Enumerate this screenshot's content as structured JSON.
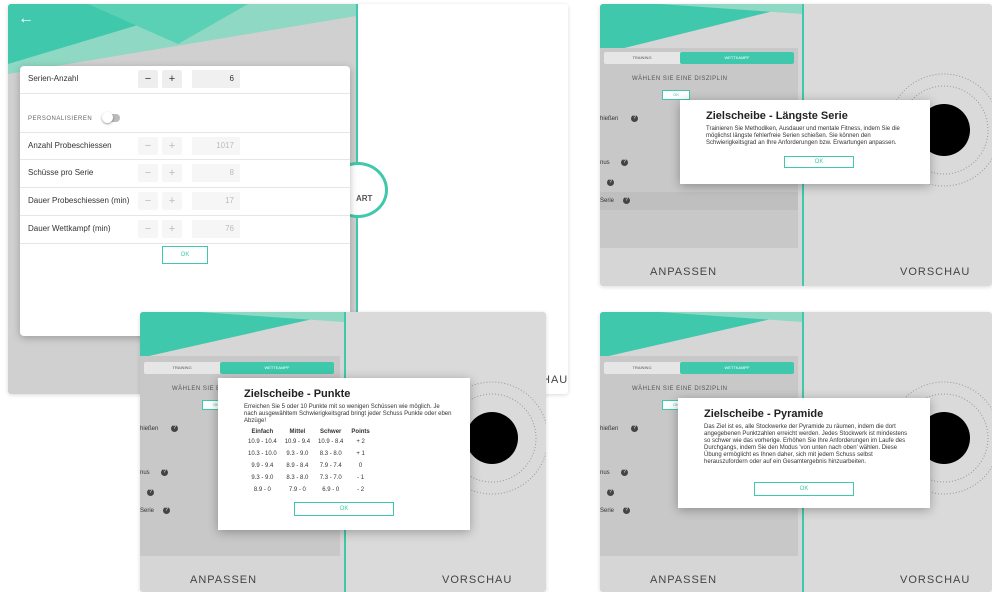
{
  "colors": {
    "accent": "#3fc8ab",
    "dark_green": "#2a8a73",
    "target_black": "#000000"
  },
  "main": {
    "back_icon": "arrow-left",
    "rows": [
      {
        "label": "Serien-Anzahl",
        "minus": "−",
        "plus": "+",
        "value": "6",
        "enabled": true
      },
      {
        "label": "Anzahl Probeschiessen",
        "minus": "−",
        "plus": "+",
        "value": "1017",
        "enabled": false
      },
      {
        "label": "Schüsse pro Serie",
        "minus": "−",
        "plus": "+",
        "value": "8",
        "enabled": false
      },
      {
        "label": "Dauer Probeschiessen (min)",
        "minus": "−",
        "plus": "+",
        "value": "17",
        "enabled": false
      },
      {
        "label": "Dauer Wettkampf (min)",
        "minus": "−",
        "plus": "+",
        "value": "76",
        "enabled": false
      }
    ],
    "personalize_label": "PERSONALISIEREN",
    "ok_label": "OK",
    "start_fragment": "ART",
    "vorschau_fragment": "HAU"
  },
  "common": {
    "tab_training": "TRAINING",
    "tab_wettkampf": "WETTKAMPF",
    "choose_label": "WÄHLEN SIE EINE DISZIPLIN",
    "ok_label": "OK",
    "footer_left": "ANPASSEN",
    "footer_right": "VORSCHAU"
  },
  "shot_top_right": {
    "choose_label": "WÄHLEN SIE EINE DISZIPLIN",
    "list": [
      "hießen",
      "nus",
      "",
      "Serie"
    ],
    "dialog_title": "Zielscheibe - Längste Serie",
    "dialog_body": "Trainieren Sie Methodiken, Ausdauer und mentale Fitness, indem Sie die möglichst längste fehlerfreie Serien schießen. Sie können den Schwierigkeitsgrad an Ihre Anforderungen bzw. Erwartungen anpassen.",
    "dialog_ok": "OK"
  },
  "shot_bottom_left": {
    "choose_label": "WÄHLEN SIE E",
    "list": [
      "hießen",
      "nus",
      "",
      "Serie"
    ],
    "dialog_title": "Zielscheibe - Punkte",
    "dialog_body": "Erreichen Sie 5 oder 10 Punkte mit so wenigen Schüssen wie möglich. Je nach ausgewähltem Schwierigkeitsgrad bringt jeder Schuss Punkte oder eben Abzüge!",
    "table_headers": [
      "Einfach",
      "Mittel",
      "Schwer",
      "Points"
    ],
    "table_rows": [
      [
        "10.9 - 10.4",
        "10.9 - 9.4",
        "10.9 - 8.4",
        "+ 2"
      ],
      [
        "10.3 - 10.0",
        "9.3 - 9.0",
        "8.3 - 8.0",
        "+ 1"
      ],
      [
        "9.9 - 9.4",
        "8.9 - 8.4",
        "7.9 - 7.4",
        "0"
      ],
      [
        "9.3 - 9.0",
        "8.3 - 8.0",
        "7.3 - 7.0",
        "- 1"
      ],
      [
        "8.9 - 0",
        "7.9 - 0",
        "6.9 - 0",
        "- 2"
      ]
    ],
    "dialog_ok": "OK"
  },
  "shot_bottom_right": {
    "choose_label": "WÄHLEN SIE EINE DISZIPLIN",
    "list": [
      "hießen",
      "nus",
      "",
      "Serie"
    ],
    "dialog_title": "Zielscheibe - Pyramide",
    "dialog_body": "Das Ziel ist es, alle Stockwerke der Pyramide zu räumen, indem die dort angegebenen Punktzahlen erreicht werden. Jedes Stockwerk ist mindestens so schwer wie das vorherige. Erhöhen Sie Ihre Anforderungen im Laufe des Durchgangs, indem Sie den Modus 'von unten nach oben' wählen. Diese Übung ermöglicht es Ihnen daher, sich mit jedem Schuss selbst herauszufordern oder auf ein Gesamtergebnis hinzuarbeiten.",
    "dialog_ok": "OK"
  }
}
